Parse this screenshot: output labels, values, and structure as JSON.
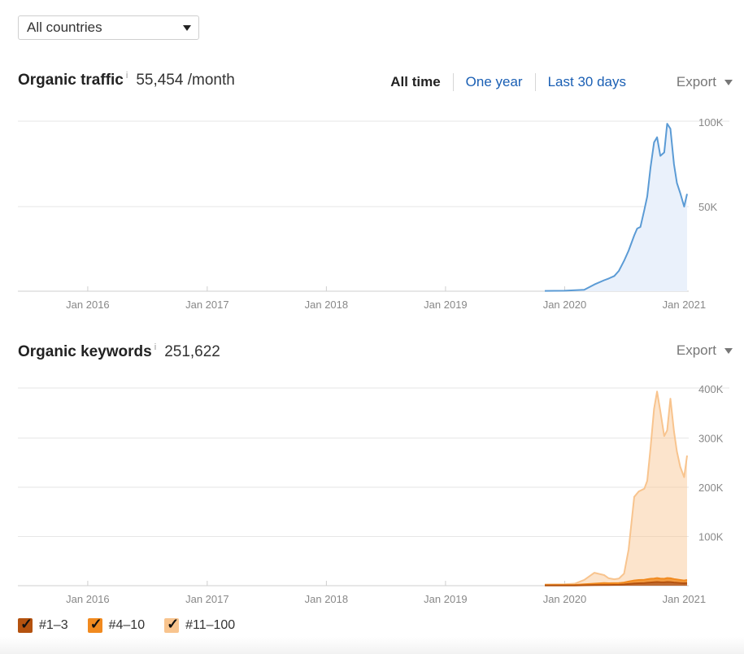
{
  "country_select": {
    "value": "All countries"
  },
  "traffic": {
    "title": "Organic traffic",
    "info": "i",
    "value": "55,454 /month",
    "tabs": [
      "All time",
      "One year",
      "Last 30 days"
    ],
    "active_tab": "All time",
    "export_label": "Export"
  },
  "keywords": {
    "title": "Organic keywords",
    "info": "i",
    "value": "251,622",
    "export_label": "Export"
  },
  "legend": [
    {
      "label": "#1–3",
      "color": "#b4520f",
      "checked": true
    },
    {
      "label": "#4–10",
      "color": "#f18a1f",
      "checked": true
    },
    {
      "label": "#11–100",
      "color": "#f8c48e",
      "checked": true
    }
  ],
  "colors": {
    "traffic_line": "#5b9bd5",
    "traffic_fill": "#eaf1fb",
    "kw_top3": "#b4520f",
    "kw_4_10": "#f18a1f",
    "kw_11_100": "#f8c48e",
    "grid": "#e6e6e6",
    "axis_text": "#888888"
  },
  "chart_data": [
    {
      "type": "line",
      "title": "Organic traffic",
      "x_range": [
        "2015-06-01",
        "2021-01-15"
      ],
      "ylim": [
        0,
        100000
      ],
      "y_ticks": [
        "50K",
        "100K"
      ],
      "y_tick_values": [
        50000,
        100000
      ],
      "x_ticks": [
        "Jan 2016",
        "Jan 2017",
        "Jan 2018",
        "Jan 2019",
        "Jan 2020",
        "Jan 2021"
      ],
      "x_tick_dates": [
        "2016-01-01",
        "2017-01-01",
        "2018-01-01",
        "2019-01-01",
        "2020-01-01",
        "2021-01-01"
      ],
      "grid": true,
      "series": [
        {
          "x": [
            "2019-11-01",
            "2020-01-01",
            "2020-03-01",
            "2020-04-01",
            "2020-05-01",
            "2020-05-15",
            "2020-06-01",
            "2020-06-15",
            "2020-07-01",
            "2020-07-15",
            "2020-08-01",
            "2020-08-10",
            "2020-08-20",
            "2020-09-01",
            "2020-09-10",
            "2020-09-20",
            "2020-10-01",
            "2020-10-10",
            "2020-10-20",
            "2020-11-01",
            "2020-11-10",
            "2020-11-20",
            "2020-12-01",
            "2020-12-10",
            "2020-12-20",
            "2021-01-01",
            "2021-01-10"
          ],
          "values": [
            200,
            300,
            800,
            4000,
            6500,
            7500,
            9000,
            12000,
            18000,
            24000,
            33000,
            37000,
            38000,
            48000,
            56000,
            73000,
            88000,
            91000,
            80000,
            82000,
            99000,
            96000,
            75000,
            64000,
            58000,
            50000,
            57500
          ]
        }
      ]
    },
    {
      "type": "area",
      "title": "Organic keywords",
      "x_range": [
        "2015-06-01",
        "2021-01-15"
      ],
      "ylim": [
        0,
        400000
      ],
      "y_ticks": [
        "100K",
        "200K",
        "300K",
        "400K"
      ],
      "y_tick_values": [
        100000,
        200000,
        300000,
        400000
      ],
      "x_ticks": [
        "Jan 2016",
        "Jan 2017",
        "Jan 2018",
        "Jan 2019",
        "Jan 2020",
        "Jan 2021"
      ],
      "x_tick_dates": [
        "2016-01-01",
        "2017-01-01",
        "2018-01-01",
        "2019-01-01",
        "2020-01-01",
        "2021-01-01"
      ],
      "grid": true,
      "stacked": true,
      "x": [
        "2019-11-01",
        "2020-01-01",
        "2020-02-01",
        "2020-03-01",
        "2020-04-01",
        "2020-05-01",
        "2020-05-15",
        "2020-06-01",
        "2020-06-15",
        "2020-07-01",
        "2020-07-15",
        "2020-08-01",
        "2020-08-15",
        "2020-09-01",
        "2020-09-10",
        "2020-09-20",
        "2020-10-01",
        "2020-10-10",
        "2020-10-20",
        "2020-11-01",
        "2020-11-10",
        "2020-11-20",
        "2020-12-01",
        "2020-12-10",
        "2020-12-20",
        "2021-01-01",
        "2021-01-10"
      ],
      "series": [
        {
          "name": "#1–3",
          "values": [
            500,
            500,
            500,
            800,
            1200,
            1500,
            1500,
            1600,
            1800,
            2500,
            3500,
            4500,
            5000,
            5500,
            6000,
            6500,
            7000,
            7500,
            7000,
            6800,
            7500,
            7200,
            6500,
            6000,
            5500,
            5000,
            5500
          ]
        },
        {
          "name": "#4–10",
          "values": [
            1000,
            1000,
            1200,
            2000,
            3000,
            4000,
            3500,
            3500,
            3500,
            4000,
            5000,
            6000,
            6500,
            6500,
            7000,
            7500,
            7500,
            8000,
            7500,
            7200,
            8000,
            7800,
            7000,
            6500,
            6000,
            5500,
            6000
          ]
        },
        {
          "name": "#11–100",
          "values": [
            1000,
            1500,
            2500,
            9000,
            22000,
            16000,
            10000,
            8000,
            9000,
            18000,
            65000,
            170000,
            180000,
            185000,
            200000,
            265000,
            345000,
            379000,
            340000,
            290000,
            300000,
            365000,
            300000,
            260000,
            230000,
            210000,
            253000
          ]
        }
      ]
    }
  ]
}
